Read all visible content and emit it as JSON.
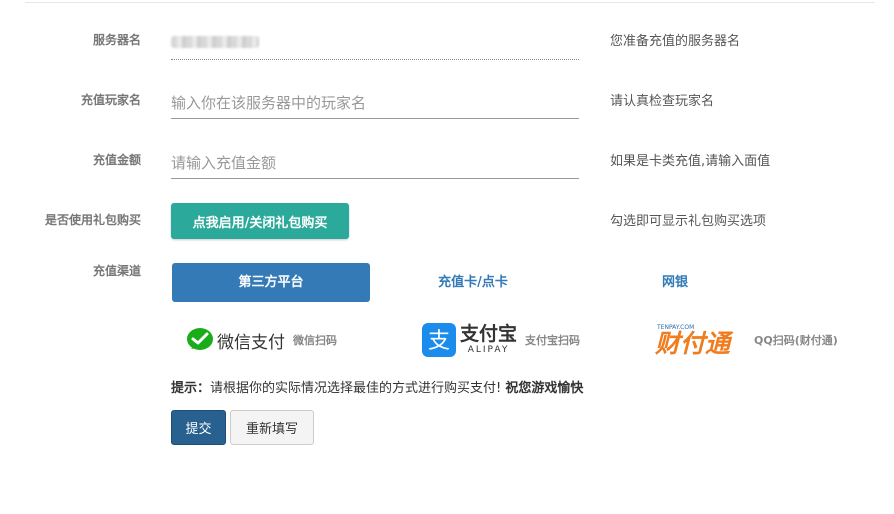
{
  "form": {
    "server": {
      "label": "服务器名",
      "hint": "您准备充值的服务器名",
      "value": ""
    },
    "player": {
      "label": "充值玩家名",
      "placeholder": "输入你在该服务器中的玩家名",
      "hint": "请认真检查玩家名"
    },
    "amount": {
      "label": "充值金额",
      "placeholder": "请输入充值金额",
      "hint": "如果是卡类充值,请输入面值"
    },
    "gift": {
      "label": "是否使用礼包购买",
      "button": "点我启用/关闭礼包购买",
      "hint": "勾选即可显示礼包购买选项"
    },
    "channel": {
      "label": "充值渠道",
      "tabs": [
        {
          "label": "第三方平台",
          "active": true
        },
        {
          "label": "充值卡/点卡",
          "active": false
        },
        {
          "label": "网银",
          "active": false
        }
      ]
    },
    "payments": {
      "wechat": {
        "logo_text": "微信支付",
        "note": "微信扫码",
        "color": "#1aad19"
      },
      "alipay": {
        "logo_text": "支付宝",
        "logo_sub": "ALIPAY",
        "note": "支付宝扫码",
        "color": "#1b8ceb"
      },
      "tenpay": {
        "logo_text": "财付通",
        "logo_sub": "TENPAY.COM",
        "note": "QQ扫码(财付通)",
        "color": "#f07c1e"
      }
    },
    "tip": {
      "prefix": "提示：",
      "text": "请根据你的实际情况选择最佳的方式进行购买支付!",
      "bold": "祝您游戏愉快"
    },
    "buttons": {
      "submit": "提交",
      "reset": "重新填写"
    }
  }
}
